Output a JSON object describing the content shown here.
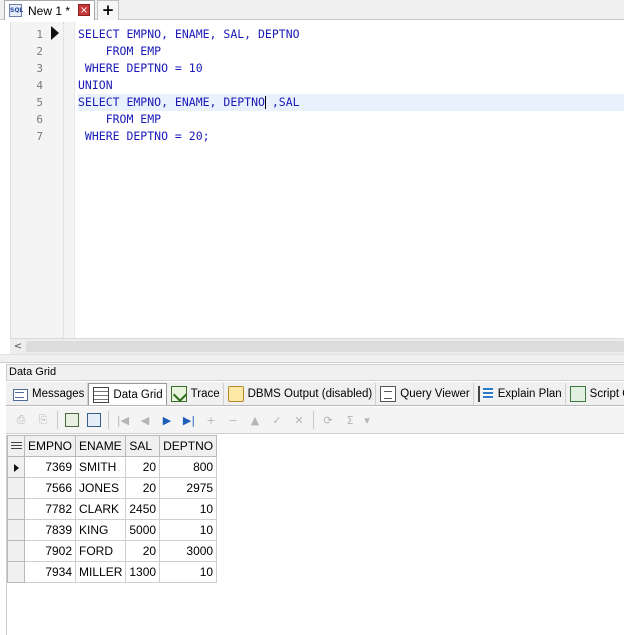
{
  "document_tab": {
    "label": "New 1 *",
    "icon": "sql-file-icon",
    "close_glyph": "×",
    "new_tab_glyph": "+"
  },
  "editor": {
    "line_numbers": [
      "1",
      "2",
      "3",
      "4",
      "5",
      "6",
      "7"
    ],
    "lines": [
      "SELECT EMPNO, ENAME, SAL, DEPTNO",
      "    FROM EMP",
      " WHERE DEPTNO = 10",
      "UNION",
      "SELECT EMPNO, ENAME, DEPTNO ,SAL",
      "    FROM EMP",
      " WHERE DEPTNO = 20;"
    ],
    "line5_before_caret": "SELECT EMPNO, ENAME, DEPTNO",
    "line5_after_caret": " ,SAL",
    "hscroll_left_glyph": "<"
  },
  "result_panel": {
    "title": "Data Grid",
    "tabs": [
      {
        "label": "Messages",
        "icon": "messages-icon"
      },
      {
        "label": "Data Grid",
        "icon": "data-grid-icon"
      },
      {
        "label": "Trace",
        "icon": "trace-icon"
      },
      {
        "label": "DBMS Output (disabled)",
        "icon": "dbms-output-icon"
      },
      {
        "label": "Query Viewer",
        "icon": "query-viewer-icon"
      },
      {
        "label": "Explain Plan",
        "icon": "explain-plan-icon"
      },
      {
        "label": "Script Output",
        "icon": "script-output-icon"
      }
    ],
    "toolbar_glyphs": {
      "first": "|◀",
      "prev": "◀",
      "next": "▶",
      "last": "▶|",
      "insert": "+",
      "delete": "−",
      "up": "▲",
      "post": "✓",
      "cancel": "✕",
      "sum": "Σ",
      "dropdown": "▾"
    }
  },
  "grid": {
    "columns": [
      "EMPNO",
      "ENAME",
      "SAL",
      "DEPTNO"
    ],
    "rows": [
      [
        "7369",
        "SMITH",
        "20",
        "800"
      ],
      [
        "7566",
        "JONES",
        "20",
        "2975"
      ],
      [
        "7782",
        "CLARK",
        "2450",
        "10"
      ],
      [
        "7839",
        "KING",
        "5000",
        "10"
      ],
      [
        "7902",
        "FORD",
        "20",
        "3000"
      ],
      [
        "7934",
        "MILLER",
        "1300",
        "10"
      ]
    ]
  },
  "colors": {
    "keyword": "#1a1ab8",
    "current_line": "#e9f2fc",
    "nav_blue": "#1d5fb8"
  }
}
